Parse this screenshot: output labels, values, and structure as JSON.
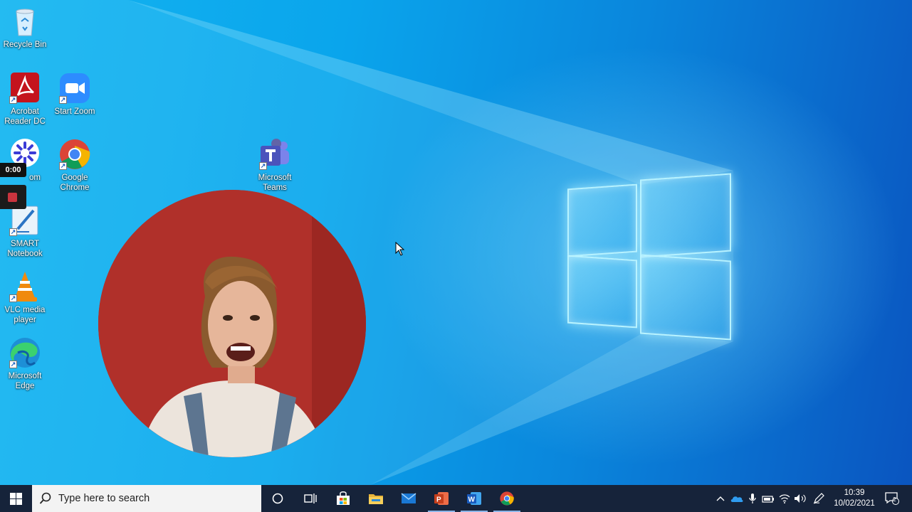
{
  "desktop": {
    "icons": [
      {
        "label": "Recycle Bin",
        "icon": "recycle-bin-icon"
      },
      {
        "label": "Acrobat Reader DC",
        "icon": "acrobat-reader-icon"
      },
      {
        "label": "Start Zoom",
        "icon": "zoom-icon"
      },
      {
        "label": "Google Chrome",
        "icon": "chrome-icon"
      },
      {
        "label": "Microsoft Teams",
        "icon": "teams-icon"
      },
      {
        "label": "SMART Notebook",
        "icon": "smart-notebook-icon"
      },
      {
        "label": "VLC media player",
        "icon": "vlc-icon"
      },
      {
        "label": "Microsoft Edge",
        "icon": "edge-icon"
      },
      {
        "label": "om",
        "icon": "screencast-o-matic-icon"
      }
    ]
  },
  "recorder": {
    "timer": "0:00",
    "stop_icon": "stop-icon"
  },
  "webcam": {
    "icon": "webcam-feed"
  },
  "taskbar": {
    "search_placeholder": "Type here to search",
    "pinned": [
      "cortana-icon",
      "task-view-icon",
      "store-icon",
      "file-explorer-icon",
      "mail-icon",
      "powerpoint-icon",
      "word-icon",
      "chrome-icon"
    ],
    "tray_icons": [
      "show-hidden-icons-chevron",
      "onedrive-icon",
      "microphone-icon",
      "battery-icon",
      "wifi-icon",
      "volume-icon",
      "pen-icon"
    ],
    "clock": {
      "time": "10:39",
      "date": "10/02/2021"
    },
    "notifications": {
      "count": "2"
    }
  },
  "colors": {
    "taskbar": "#16233a",
    "desktop_accent": "#0a8ae0",
    "webcam_background": "#b0302a"
  }
}
